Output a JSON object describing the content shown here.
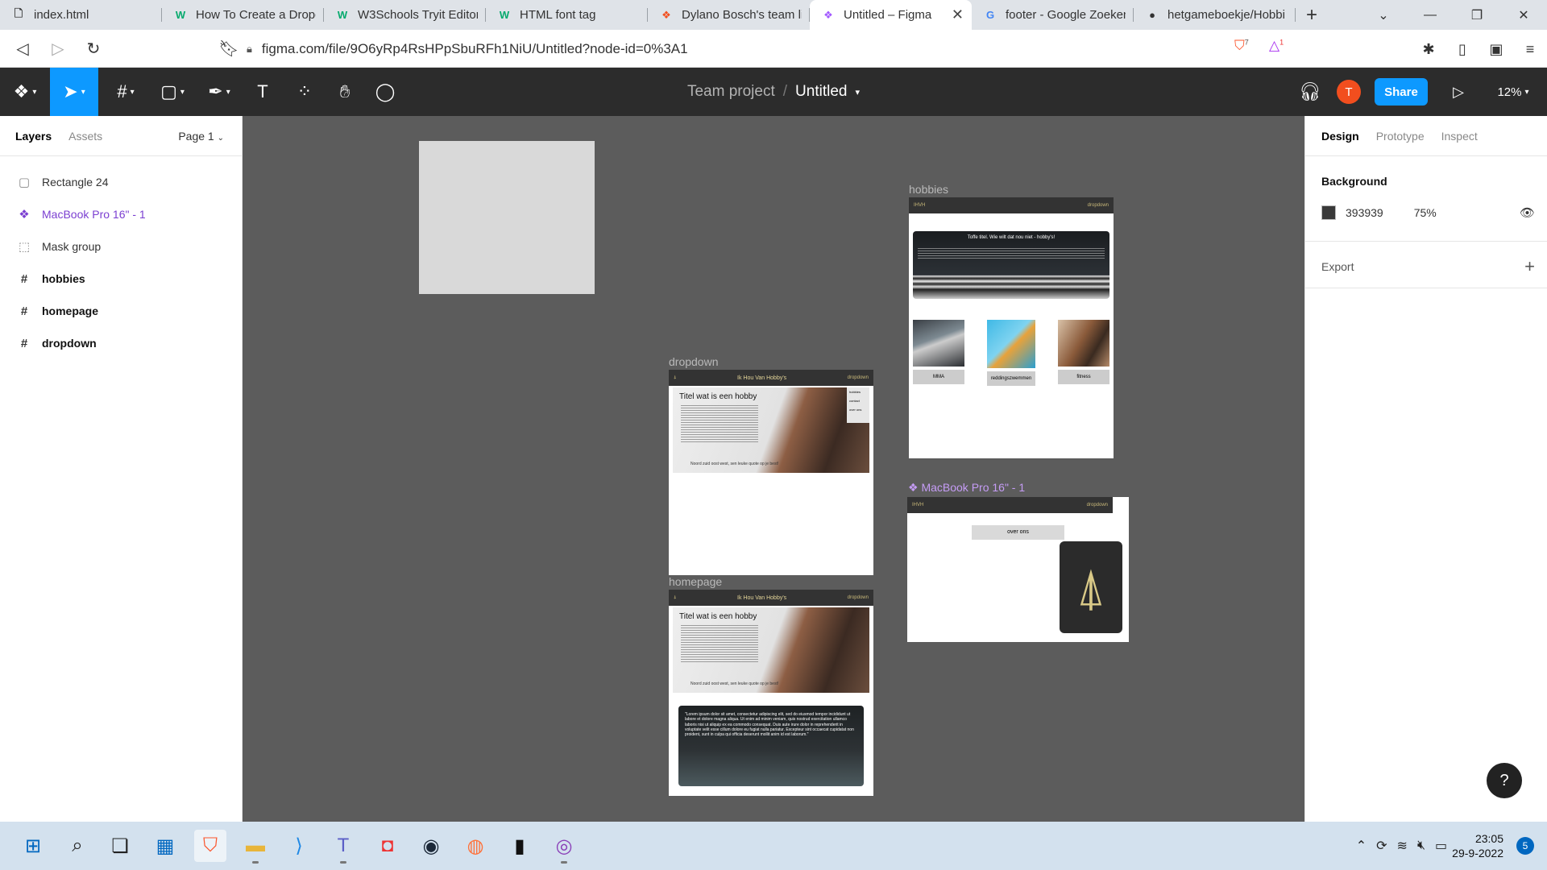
{
  "browser": {
    "tabs": [
      {
        "title": "index.html",
        "icon": "file-icon"
      },
      {
        "title": "How To Create a Dropd",
        "icon": "w3schools-icon"
      },
      {
        "title": "W3Schools Tryit Editor",
        "icon": "w3schools-icon"
      },
      {
        "title": "HTML font tag",
        "icon": "w3schools-icon"
      },
      {
        "title": "Dylano Bosch's team li",
        "icon": "figma-icon"
      },
      {
        "title": "Untitled – Figma",
        "icon": "figma-icon"
      },
      {
        "title": "footer - Google Zoeken",
        "icon": "google-icon"
      },
      {
        "title": "hetgameboekje/Hobbi",
        "icon": "github-icon"
      }
    ],
    "url": "figma.com/file/9O6yRp4RsHPpSbuRFh1NiU/Untitled?node-id=0%3A1",
    "brave_shield_count": "7",
    "brave_rewards_count": "1"
  },
  "figma": {
    "project": "Team project",
    "file_name": "Untitled",
    "avatar_initial": "T",
    "share_label": "Share",
    "zoom": "12%"
  },
  "left_panel": {
    "tab_layers": "Layers",
    "tab_assets": "Assets",
    "page": "Page 1",
    "layers": [
      {
        "name": "Rectangle 24",
        "type": "rectangle"
      },
      {
        "name": "MacBook Pro 16\" - 1",
        "type": "component"
      },
      {
        "name": "Mask group",
        "type": "mask"
      },
      {
        "name": "hobbies",
        "type": "frame"
      },
      {
        "name": "homepage",
        "type": "frame"
      },
      {
        "name": "dropdown",
        "type": "frame"
      }
    ]
  },
  "canvas": {
    "background": "#5c5c5c",
    "labels": {
      "hobbies": "hobbies",
      "dropdown": "dropdown",
      "homepage": "homepage",
      "macbook": "MacBook Pro 16\" - 1"
    },
    "site": {
      "logo_text": "IHVH",
      "nav_title": "Ik Hou Van Hobby's",
      "dropdown_label": "dropdown",
      "hero_title": "Titel wat is een hobby",
      "hero_foot": "Noord zuid oost west, sen leuke quote op je best!",
      "menu_items": [
        "hobbies",
        "contact",
        "over ons"
      ],
      "hobbies_card_title": "Toffe titel. Wie wilt dat nou niet - hobby's!",
      "hobby_items": [
        "MMA",
        "reddingszwemmen",
        "fitness"
      ],
      "quote": "\"Lorem ipsum dolor sit amet, consectetur adipiscing elit, sed do eiusmod tempor incididunt ut labore et dolore magna aliqua. Ut enim ad minim veniam, quis nostrud exercitation ullamco laboris nisi ut aliquip ex ea commodo consequat. Duis aute irure dolor in reprehenderit in voluptate velit esse cillum dolore eu fugiat nulla pariatur. Excepteur sint occaecat cupidatat non proident, sunt in culpa qui officia deserunt mollit anim id est laborum.\"",
      "about_button": "over ons"
    }
  },
  "right_panel": {
    "tab_design": "Design",
    "tab_prototype": "Prototype",
    "tab_inspect": "Inspect",
    "background_title": "Background",
    "background_hex": "393939",
    "background_color": "#393939",
    "background_opacity": "75%",
    "export_label": "Export",
    "help": "?"
  },
  "taskbar": {
    "time": "23:05",
    "date": "29-9-2022",
    "notifications": "5"
  }
}
